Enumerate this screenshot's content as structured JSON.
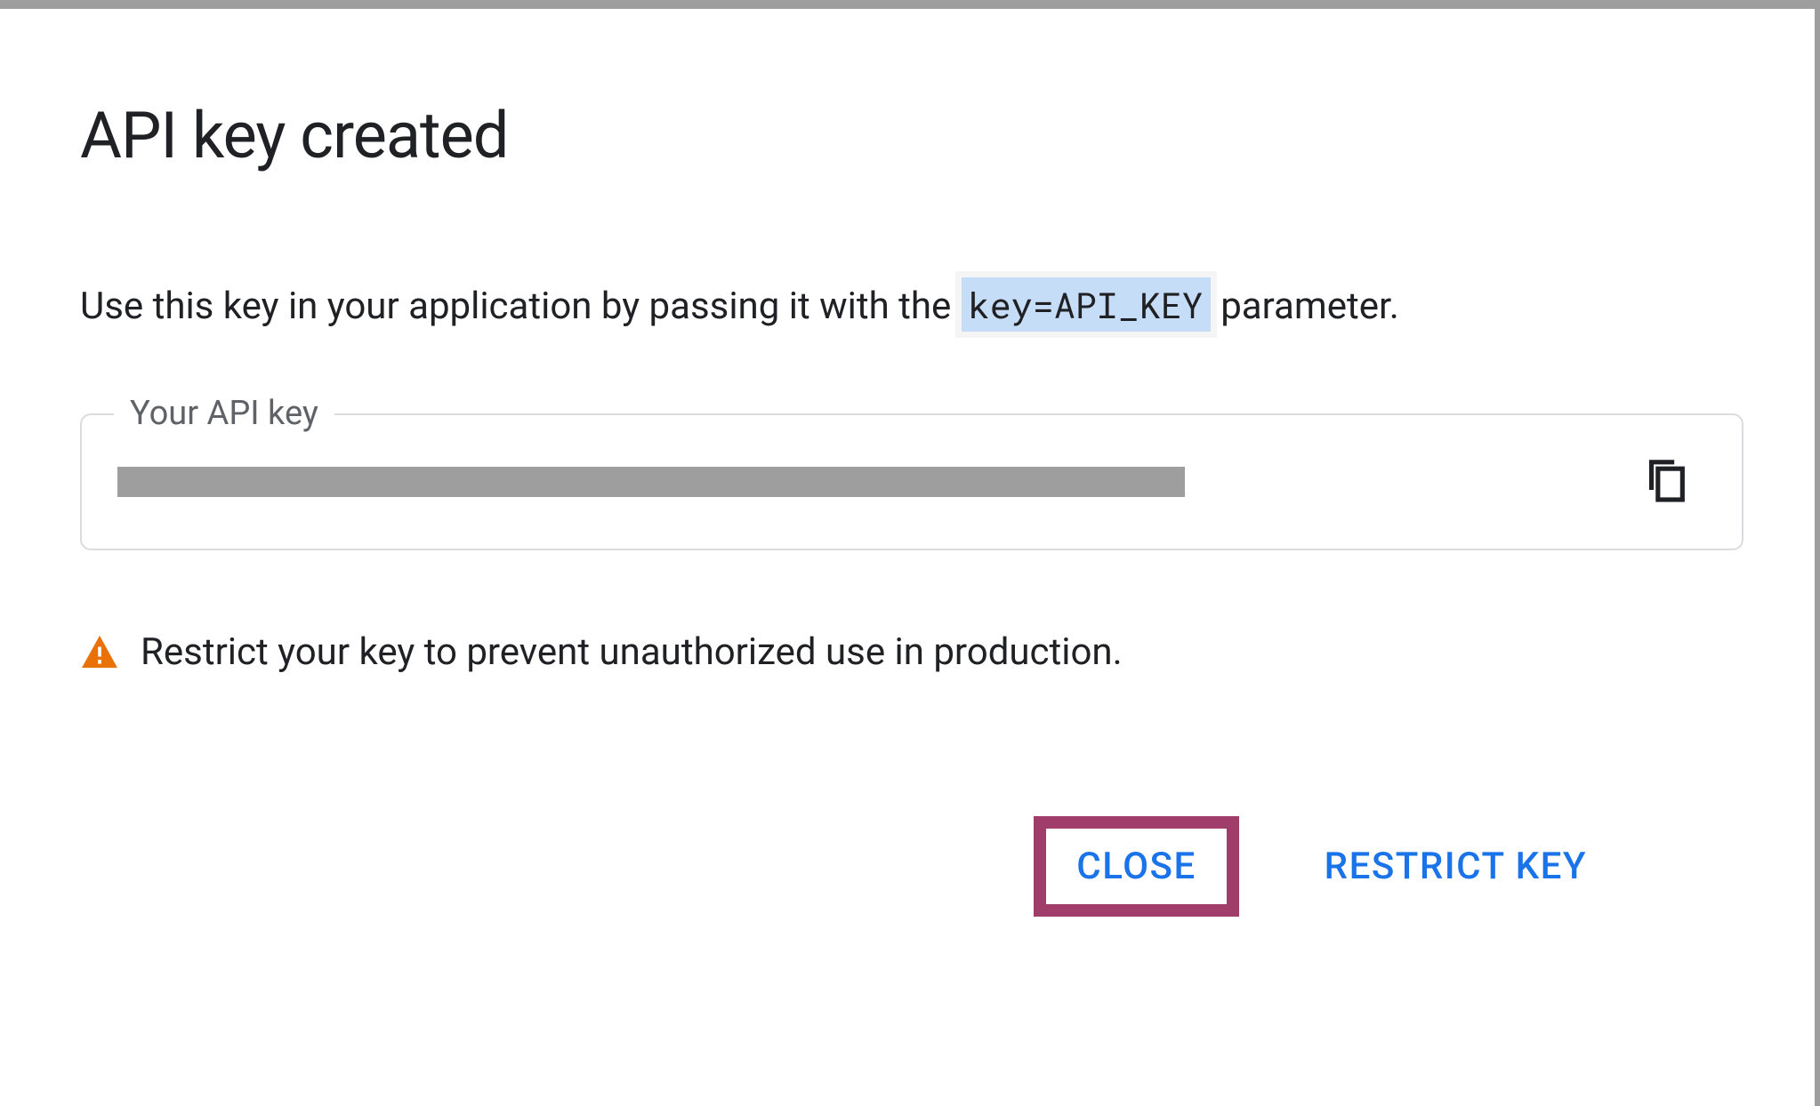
{
  "dialog": {
    "title": "API key created",
    "description_prefix": "Use this key in your application by passing it with the ",
    "description_code": "key=API_KEY",
    "description_suffix": " parameter.",
    "field_label": "Your API key",
    "warning_text": "Restrict your key to prevent unauthorized use in production.",
    "actions": {
      "close": "CLOSE",
      "restrict": "RESTRICT KEY"
    }
  }
}
